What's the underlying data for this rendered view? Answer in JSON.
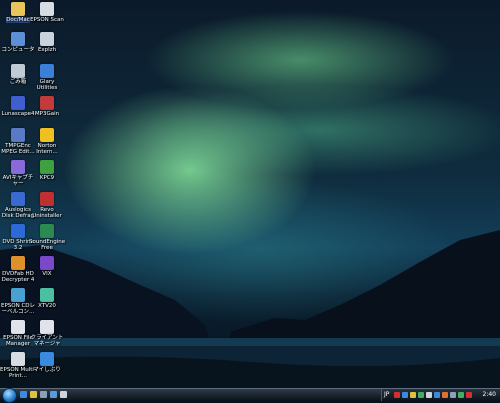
{
  "desktop": {
    "icons": [
      {
        "label": "Doc/Mac",
        "icon": "folder-icon",
        "color": "#e8c45a"
      },
      {
        "label": "EPSON Scan",
        "icon": "scanner-icon",
        "color": "#d8dde4"
      },
      {
        "label": "コンピュータ",
        "icon": "computer-icon",
        "color": "#5d8fd6"
      },
      {
        "label": "Explzh",
        "icon": "archive-icon",
        "color": "#c9d3de"
      },
      {
        "label": "ごみ箱",
        "icon": "recycle-bin-icon",
        "color": "#bfcad6"
      },
      {
        "label": "Glary Utilities",
        "icon": "utilities-icon",
        "color": "#3a7fd8"
      },
      {
        "label": "Lunascape4",
        "icon": "browser-icon",
        "color": "#3f5fd0"
      },
      {
        "label": "MP3Gain",
        "icon": "audio-icon",
        "color": "#c23a3a"
      },
      {
        "label": "TMPGEnc MPEG Edit...",
        "icon": "video-editor-icon",
        "color": "#5a7ac8"
      },
      {
        "label": "Norton Intern...",
        "icon": "norton-icon",
        "color": "#f0c020"
      },
      {
        "label": "AVIキャプチャー",
        "icon": "capture-icon",
        "color": "#8a6ad8"
      },
      {
        "label": "KPC9",
        "icon": "kpc-icon",
        "color": "#3fa040"
      },
      {
        "label": "Auslogics Disk Defrag",
        "icon": "defrag-icon",
        "color": "#3a6ad0"
      },
      {
        "label": "Revo Uninstaller",
        "icon": "uninstaller-icon",
        "color": "#c03030"
      },
      {
        "label": "DVD Shrink 3.2",
        "icon": "dvd-shrink-icon",
        "color": "#2d6ad8"
      },
      {
        "label": "SoundEngine Free",
        "icon": "sound-engine-icon",
        "color": "#2a8a50"
      },
      {
        "label": "DVDFab HD Decrypter 4",
        "icon": "dvdfab-icon",
        "color": "#e0902a"
      },
      {
        "label": "VIX",
        "icon": "vix-icon",
        "color": "#7a48c8"
      },
      {
        "label": "EPSON CDレーベルコン...",
        "icon": "cd-label-icon",
        "color": "#4aa0d0"
      },
      {
        "label": "XTV20",
        "icon": "tv-icon",
        "color": "#4ac0a0"
      },
      {
        "label": "EPSON File Manager",
        "icon": "file-manager-icon",
        "color": "#e0e4ea"
      },
      {
        "label": "クライアントマネージャ",
        "icon": "client-manager-icon",
        "color": "#e0e4ea"
      },
      {
        "label": "EPSON Multi-Print...",
        "icon": "multi-print-icon",
        "color": "#d8dde4"
      },
      {
        "label": "マイしぶり",
        "icon": "app-icon",
        "color": "#3a8ae0"
      }
    ]
  },
  "taskbar": {
    "language": "JP",
    "clock": "2:40",
    "quick_launch": [
      "#3a8ae0",
      "#e0c040",
      "#8aa0b8",
      "#5a9ad8",
      "#d0d4da"
    ],
    "tray_icons": [
      "#d03030",
      "#3a8ae0",
      "#e0c040",
      "#40b060",
      "#d0d4da",
      "#3a8ae0",
      "#e07030",
      "#8aa0b8",
      "#40b060",
      "#d03030"
    ]
  }
}
